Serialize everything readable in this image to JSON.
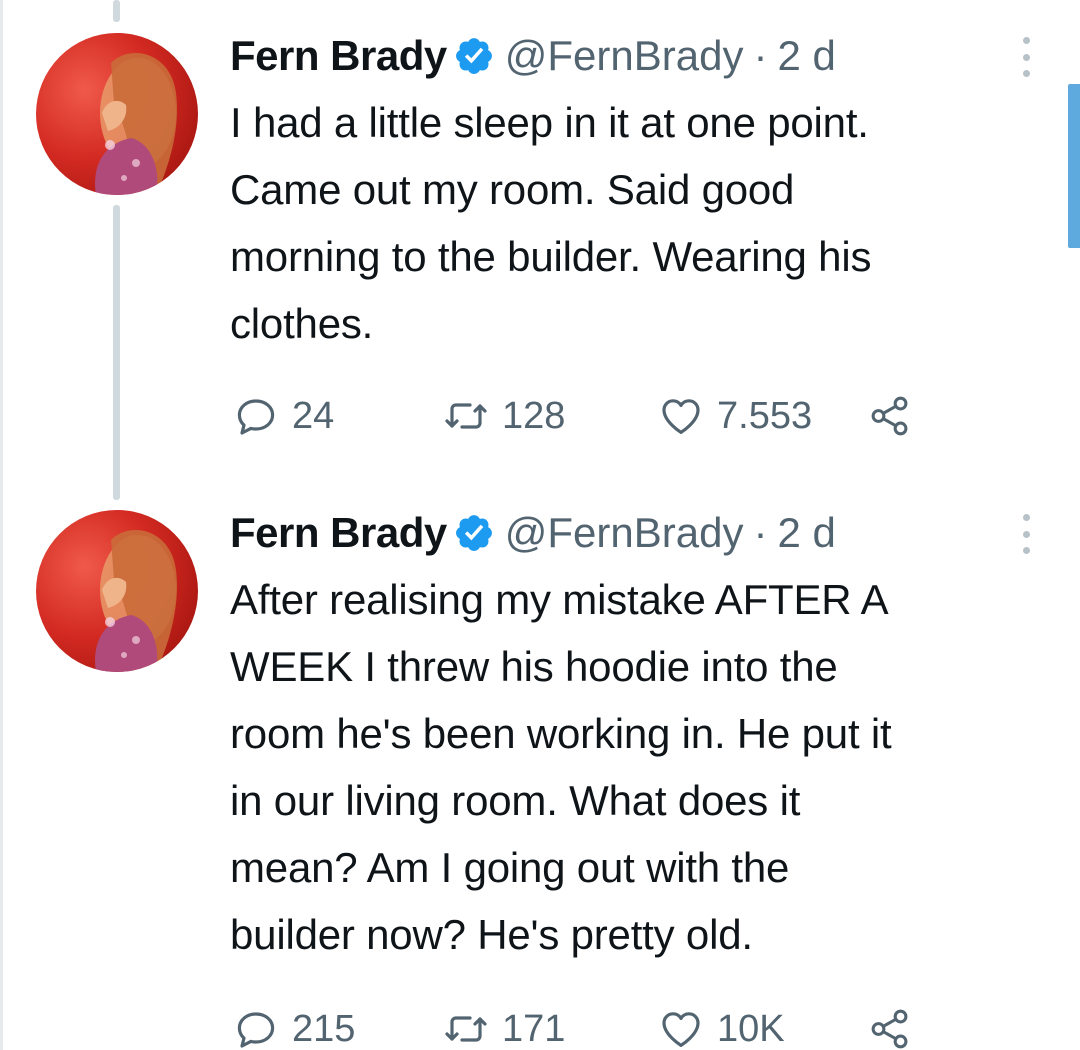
{
  "tweets": [
    {
      "author": {
        "name": "Fern Brady",
        "handle": "@FernBrady",
        "verified_icon": "verified-badge-icon",
        "avatar": "profile-photo"
      },
      "separator": "·",
      "time": "2 d",
      "text_lines": [
        "I had a little sleep in it at one point.",
        "Came out my room. Said good",
        "morning to the builder. Wearing his",
        "clothes."
      ],
      "stats": {
        "replies": "24",
        "retweets": "128",
        "likes": "7.553"
      }
    },
    {
      "author": {
        "name": "Fern Brady",
        "handle": "@FernBrady",
        "verified_icon": "verified-badge-icon",
        "avatar": "profile-photo"
      },
      "separator": "·",
      "time": "2 d",
      "text_lines": [
        "After realising my mistake AFTER A",
        "WEEK I threw his hoodie into the",
        "room he's been working in. He put it",
        "in our living room. What does it",
        "mean? Am I going out with the",
        "builder now? He's pretty old."
      ],
      "stats": {
        "replies": "215",
        "retweets": "171",
        "likes": "10K"
      }
    }
  ],
  "colors": {
    "text": "#0f1419",
    "secondary": "#536471",
    "verified": "#1d9bf0",
    "thread_line": "#cfd9de"
  }
}
